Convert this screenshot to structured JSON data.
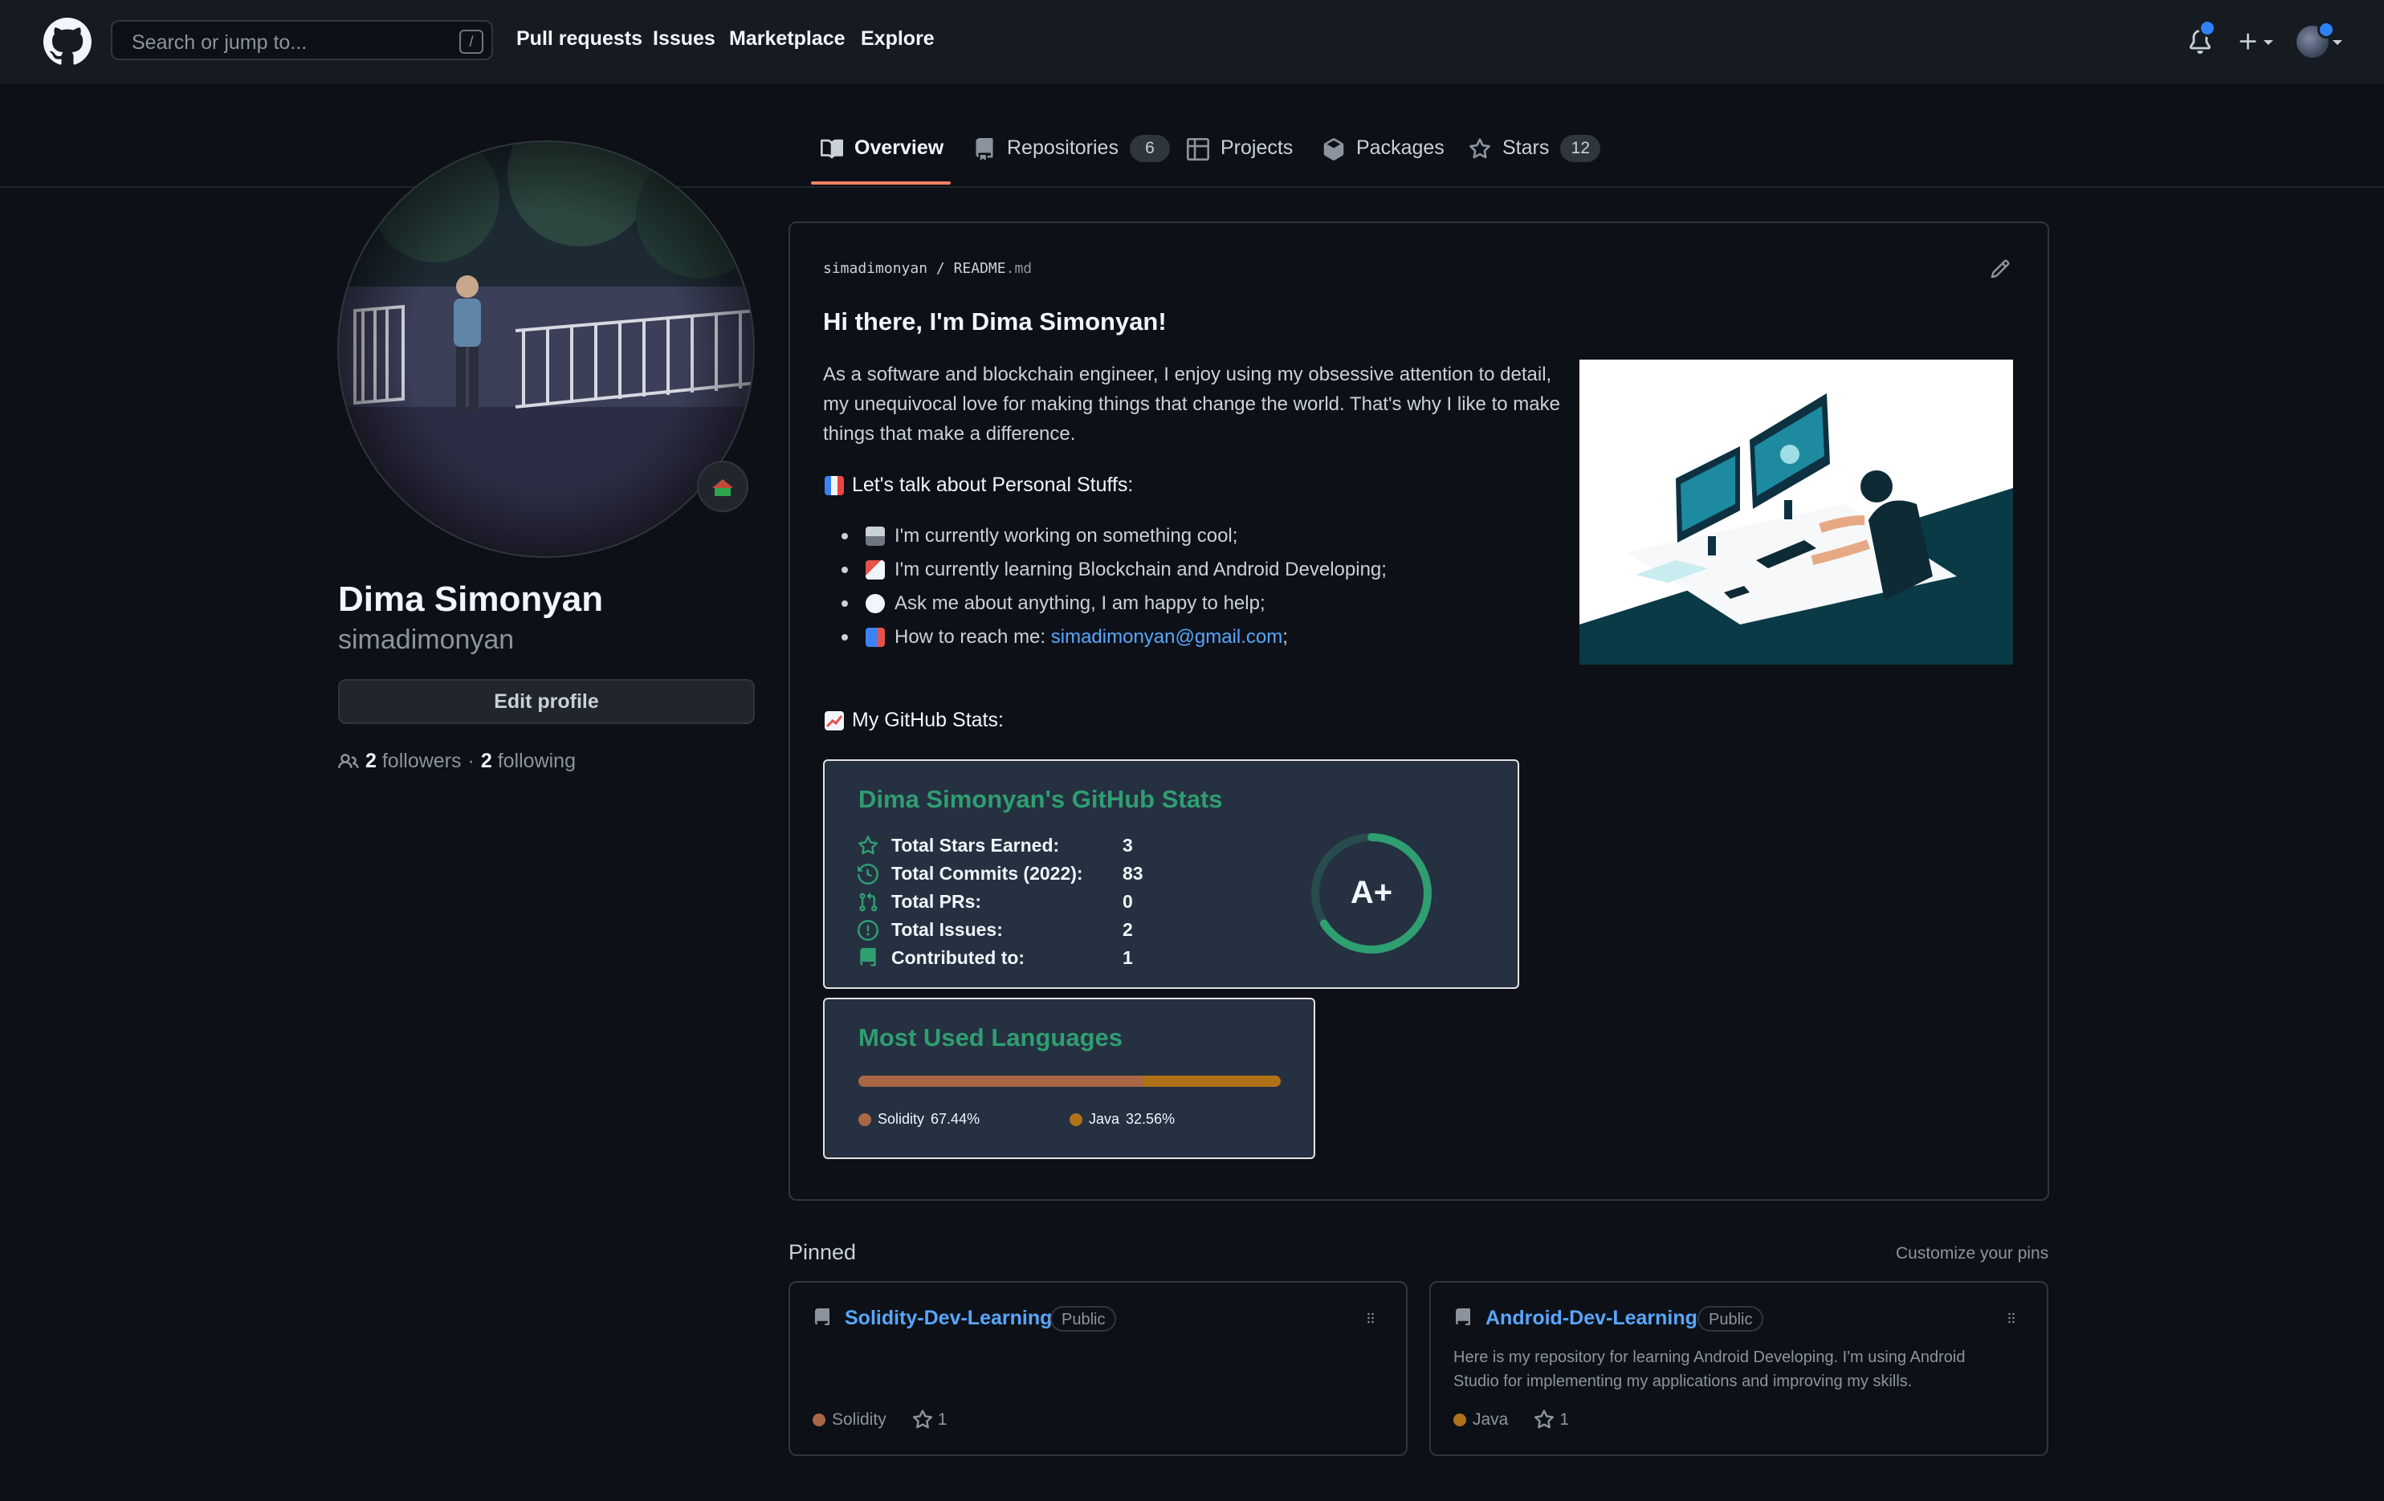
{
  "header": {
    "search_placeholder": "Search or jump to...",
    "search_shortcut": "/",
    "nav": [
      "Pull requests",
      "Issues",
      "Marketplace",
      "Explore"
    ]
  },
  "tabs": [
    {
      "label": "Overview",
      "count": null
    },
    {
      "label": "Repositories",
      "count": "6"
    },
    {
      "label": "Projects",
      "count": null
    },
    {
      "label": "Packages",
      "count": null
    },
    {
      "label": "Stars",
      "count": "12"
    }
  ],
  "profile": {
    "full_name": "Dima Simonyan",
    "username": "simadimonyan",
    "edit_button": "Edit profile",
    "followers_count": "2",
    "followers_label": "followers",
    "separator": "·",
    "following_count": "2",
    "following_label": "following"
  },
  "readme": {
    "crumb_user": "simadimonyan",
    "crumb_sep": "/",
    "crumb_file": "README",
    "crumb_ext": ".md",
    "greeting": "Hi there, I'm Dima Simonyan!",
    "intro_line1": "As a software and blockchain engineer, I enjoy using my obsessive attention to detail,",
    "intro_line2": "my unequivocal love for making things that change the world. That's why I like to make",
    "intro_line3": "things that make a difference.",
    "personal_heading": "Let's talk about Personal Stuffs:",
    "list": [
      "I'm currently working on something cool;",
      "I'm currently learning Blockchain and Android Developing;",
      "Ask me about anything, I am happy to help;",
      "How to reach me: "
    ],
    "email": "simadimonyan@gmail.com",
    "email_suffix": ";",
    "stats_heading": "My GitHub Stats:"
  },
  "stats_card": {
    "title": "Dima Simonyan's GitHub Stats",
    "rows": [
      {
        "label": "Total Stars Earned:",
        "value": "3"
      },
      {
        "label": "Total Commits (2022):",
        "value": "83"
      },
      {
        "label": "Total PRs:",
        "value": "0"
      },
      {
        "label": "Total Issues:",
        "value": "2"
      },
      {
        "label": "Contributed to:",
        "value": "1"
      }
    ],
    "grade": "A+",
    "accent": "#2f9e71"
  },
  "languages_card": {
    "title": "Most Used Languages",
    "languages": [
      {
        "name": "Solidity",
        "percent": "67.44%",
        "fraction": 0.6744,
        "color": "#AA6746"
      },
      {
        "name": "Java",
        "percent": "32.56%",
        "fraction": 0.3256,
        "color": "#b07219"
      }
    ]
  },
  "pinned": {
    "heading": "Pinned",
    "customize": "Customize your pins",
    "repos": [
      {
        "name": "Solidity-Dev-Learning",
        "visibility": "Public",
        "description": "",
        "language": "Solidity",
        "lang_color": "#AA6746",
        "stars": "1"
      },
      {
        "name": "Android-Dev-Learning",
        "visibility": "Public",
        "description_line1": "Here is my repository for learning Android Developing. I'm using Android",
        "description_line2": "Studio for implementing my applications and improving my skills.",
        "language": "Java",
        "lang_color": "#b07219",
        "stars": "1"
      }
    ]
  },
  "colors": {
    "link": "#58a6ff",
    "tab_underline": "#f78166",
    "bg": "#0d1117",
    "header_bg": "#161b22"
  }
}
